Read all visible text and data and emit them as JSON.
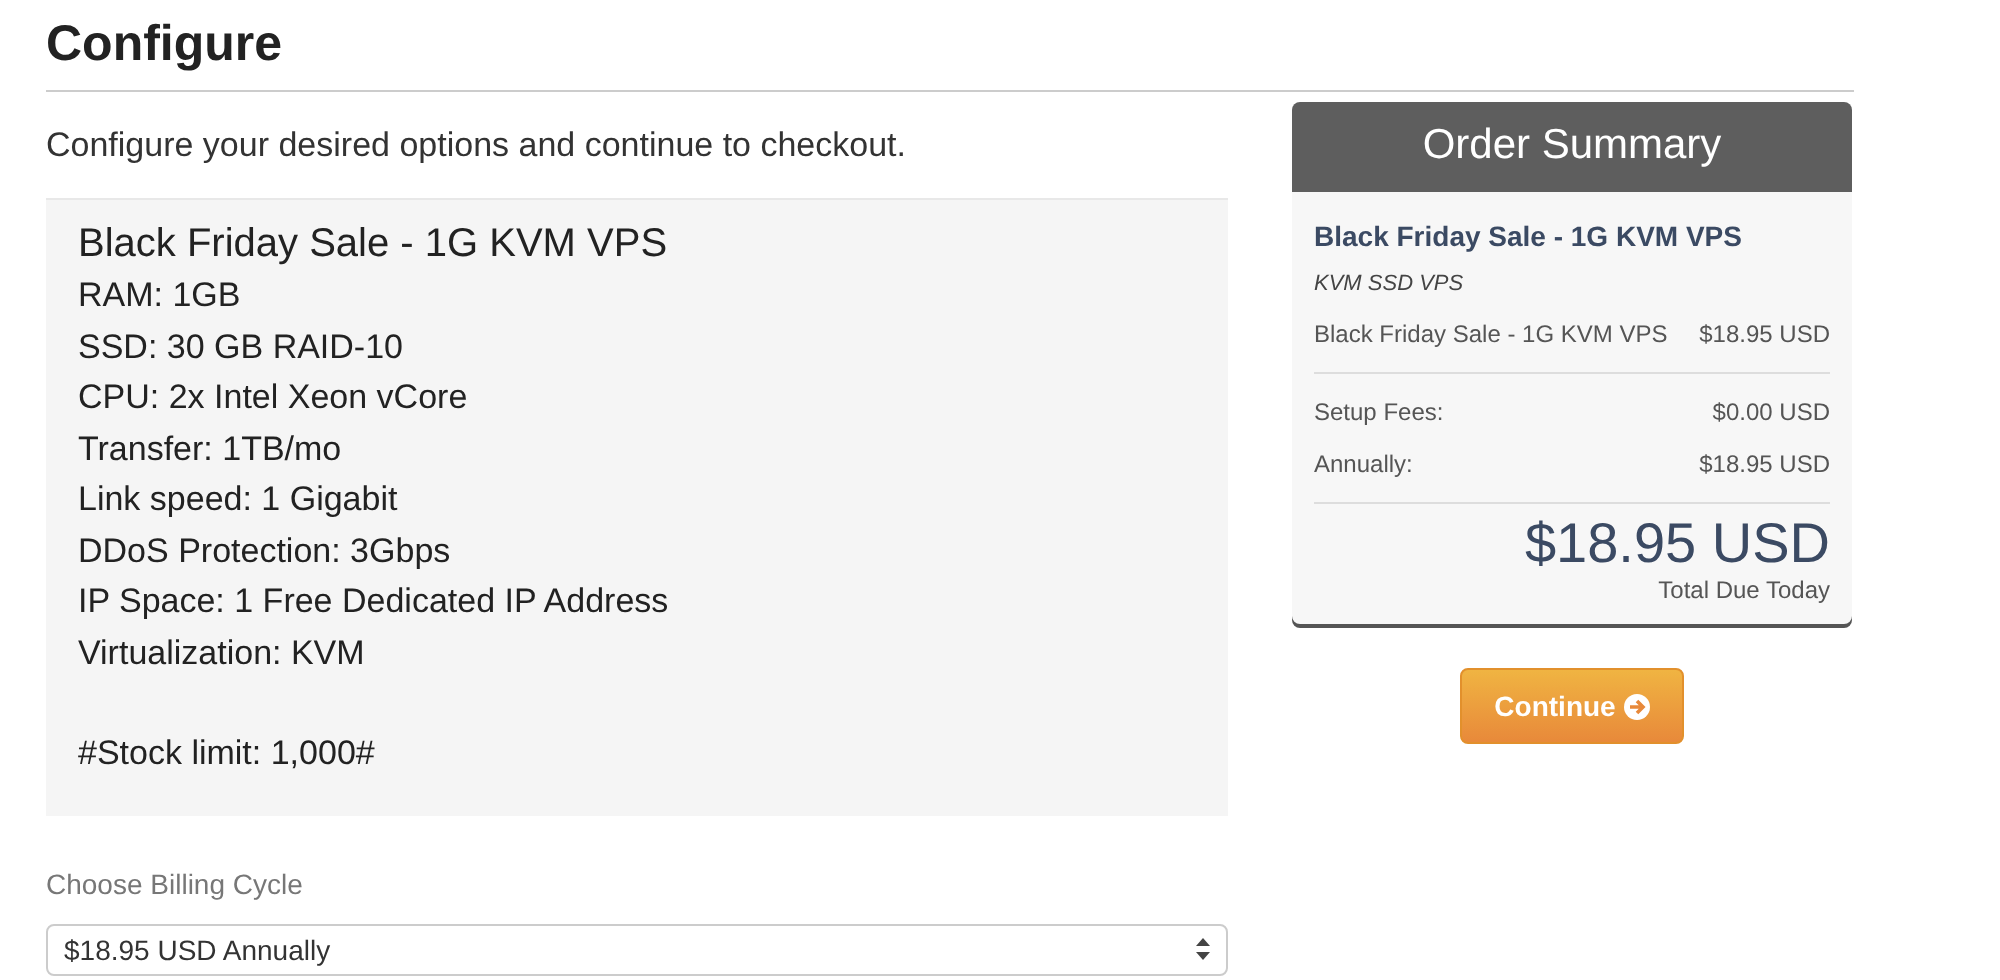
{
  "page_title": "Configure",
  "intro": "Configure your desired options and continue to checkout.",
  "product": {
    "title": "Black Friday Sale - 1G KVM VPS",
    "details": [
      "RAM: 1GB",
      "SSD: 30 GB RAID-10",
      "CPU: 2x Intel Xeon vCore",
      "Transfer: 1TB/mo",
      "Link speed: 1 Gigabit",
      "DDoS Protection: 3Gbps",
      "IP Space: 1 Free Dedicated IP Address",
      "Virtualization: KVM"
    ],
    "note": "#Stock limit: 1,000#"
  },
  "billing": {
    "label": "Choose Billing Cycle",
    "value": "$18.95 USD Annually"
  },
  "order_summary": {
    "title": "Order Summary",
    "product_name": "Black Friday Sale - 1G KVM VPS",
    "product_group": "KVM SSD VPS",
    "item_lines": [
      {
        "label": "Black Friday Sale - 1G KVM VPS",
        "amount": "$18.95 USD"
      }
    ],
    "fee_lines": [
      {
        "label": "Setup Fees:",
        "amount": "$0.00 USD"
      },
      {
        "label": "Annually:",
        "amount": "$18.95 USD"
      }
    ],
    "total": "$18.95 USD",
    "total_label": "Total Due Today"
  },
  "continue_button": {
    "label": "Continue"
  }
}
